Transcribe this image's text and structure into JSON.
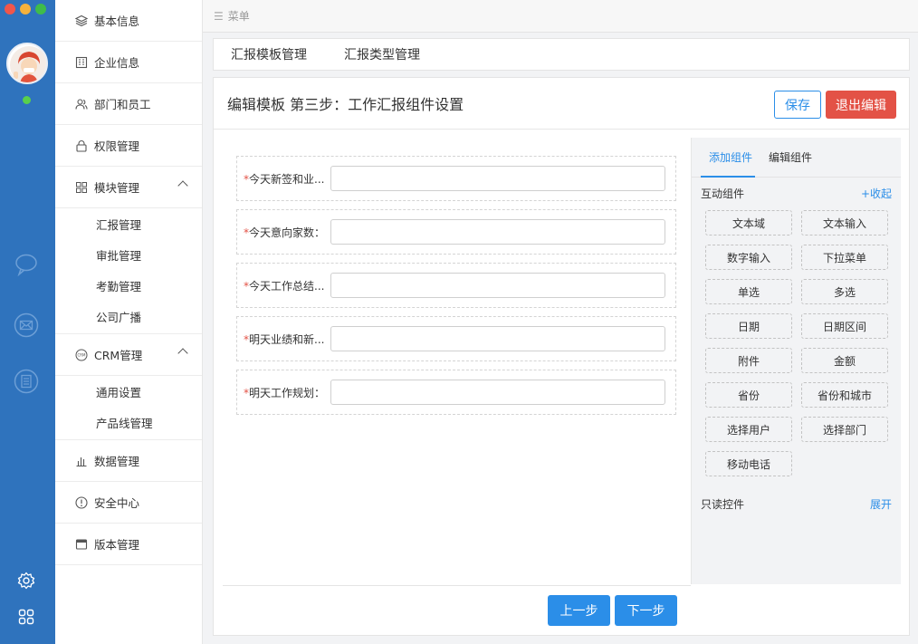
{
  "window": {
    "traffic_colors": [
      "#f0564b",
      "#f6b23c",
      "#3fbc4a"
    ]
  },
  "rail": {
    "icons": [
      "chat-bubble-icon",
      "mail-icon",
      "list-doc-icon",
      "settings-gear-icon",
      "apps-grid-icon"
    ],
    "status_color": "#59d04b"
  },
  "sidebar": {
    "items": [
      {
        "label": "基本信息",
        "icon": "layers-icon"
      },
      {
        "label": "企业信息",
        "icon": "building-icon"
      },
      {
        "label": "部门和员工",
        "icon": "users-icon"
      },
      {
        "label": "权限管理",
        "icon": "lock-icon"
      },
      {
        "label": "模块管理",
        "icon": "modules-icon",
        "children": [
          "汇报管理",
          "审批管理",
          "考勤管理",
          "公司广播"
        ]
      },
      {
        "label": "CRM管理",
        "icon": "crm-icon",
        "children": [
          "通用设置",
          "产品线管理"
        ]
      },
      {
        "label": "数据管理",
        "icon": "bar-chart-icon"
      },
      {
        "label": "安全中心",
        "icon": "alert-circle-icon"
      },
      {
        "label": "版本管理",
        "icon": "window-icon"
      }
    ]
  },
  "topbar": {
    "menu_label": "菜单"
  },
  "tabs": [
    "汇报模板管理",
    "汇报类型管理"
  ],
  "panel": {
    "title": "编辑模板 第三步：工作汇报组件设置",
    "save_label": "保存",
    "exit_label": "退出编辑",
    "prev_label": "上一步",
    "next_label": "下一步"
  },
  "form": {
    "fields": [
      {
        "required": "*",
        "label": "今天新签和业..."
      },
      {
        "required": "*",
        "label": "今天意向家数："
      },
      {
        "required": "*",
        "label": "今天工作总结..."
      },
      {
        "required": "*",
        "label": "明天业绩和新..."
      },
      {
        "required": "*",
        "label": "明天工作规划："
      }
    ]
  },
  "components": {
    "tab_add": "添加组件",
    "tab_edit": "编辑组件",
    "interactive_title": "互动组件",
    "interactive_toggle": "+收起",
    "items": [
      "文本域",
      "文本输入",
      "数字输入",
      "下拉菜单",
      "单选",
      "多选",
      "日期",
      "日期区间",
      "附件",
      "金额",
      "省份",
      "省份和城市",
      "选择用户",
      "选择部门",
      "移动电话"
    ],
    "readonly_title": "只读控件",
    "readonly_toggle": "展开"
  },
  "colors": {
    "accent": "#2b8ee8",
    "danger": "#e35246",
    "rail": "#2f73bd"
  }
}
